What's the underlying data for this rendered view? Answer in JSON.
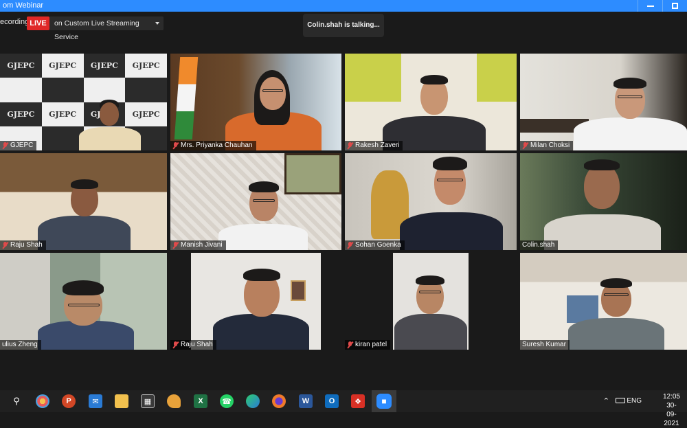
{
  "window": {
    "title": "om Webinar"
  },
  "topbar": {
    "recording_label": "ecording",
    "live_label": "LIVE",
    "stream_service": "on Custom Live Streaming Service",
    "talking_notice": "Colin.shah is talking..."
  },
  "backdrop": {
    "logo_text": "GJEPC"
  },
  "participants": [
    {
      "name": "GJEPC",
      "muted": true
    },
    {
      "name": "Mrs. Priyanka Chauhan",
      "muted": true
    },
    {
      "name": "Rakesh Zaveri",
      "muted": true
    },
    {
      "name": "Milan Choksi",
      "muted": true
    },
    {
      "name": "Raju Shah",
      "muted": true
    },
    {
      "name": "Manish Jivani",
      "muted": true
    },
    {
      "name": "Sohan Goenka",
      "muted": true
    },
    {
      "name": "Colin.shah",
      "muted": false,
      "active_speaker": true
    },
    {
      "name": "ulius Zheng",
      "muted": true
    },
    {
      "name": "Raju Shah",
      "muted": true
    },
    {
      "name": "kiran patel",
      "muted": true
    },
    {
      "name": "Suresh Kumar",
      "muted": true
    }
  ],
  "taskbar": {
    "apps": [
      "search-icon",
      "paint-icon",
      "powerpoint-icon",
      "mail-icon",
      "file-explorer-icon",
      "store-icon",
      "paint-palette-icon",
      "excel-icon",
      "whatsapp-icon",
      "edge-icon",
      "firefox-icon",
      "word-icon",
      "outlook-icon",
      "acrobat-icon",
      "zoom-icon"
    ],
    "tray": {
      "language": "ENG",
      "time": "12:05",
      "date": "30-09-2021"
    }
  },
  "colors": {
    "titlebar": "#2d8cff",
    "live": "#e02828",
    "active_speaker": "#b8e03c",
    "muted": "#e04a4a"
  }
}
